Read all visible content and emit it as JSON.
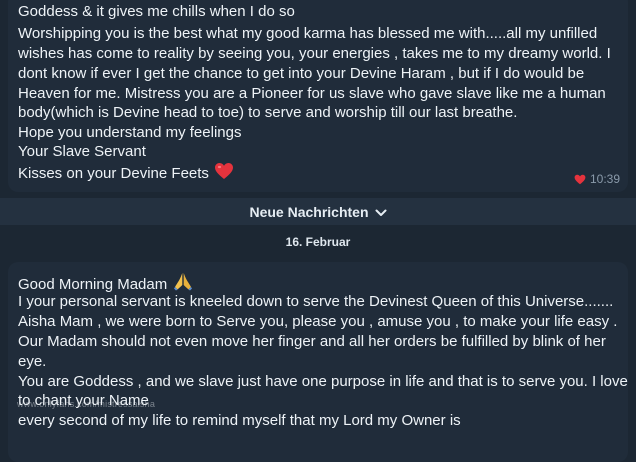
{
  "message_top": {
    "lines": [
      "Goddess & it gives me chills when I do so",
      "Worshipping you is the best what my good karma has blessed me with.....all my unfilled",
      "wishes has come to reality by seeing you,  your energies , takes me to my dreamy world. I",
      "dont know if ever I get the chance to get into your Devine Haram , but if I do would be",
      "Heaven for me. Mistress you are a Pioneer for us slave who gave slave like me a human",
      "body(which is Devine head to toe) to serve and worship till our last breathe.",
      "Hope you understand my feelings",
      "Your Slave Servant",
      "Kisses on your Devine Feets"
    ],
    "emoji": "❤️",
    "reaction_icon": "heart-icon",
    "time": "10:39"
  },
  "new_messages": {
    "label": "Neue Nachrichten",
    "icon": "chevron-down-icon"
  },
  "date_divider": "16. Februar",
  "message_bottom": {
    "lines": [
      "Good Morning Madam",
      "I your personal servant is kneeled down to serve the Devinest Queen of this Universe.......",
      "Aisha Mam , we were born to Serve you, please you , amuse you , to make your life easy .",
      "Our Madam should not even move her finger and all her orders be fulfilled by blink of her",
      "eye.",
      "You are Goddess , and we slave just have one purpose in life and that is to serve you. I love",
      "to chant your Name",
      "every second of my life to remind myself that my Lord my Owner is"
    ],
    "emoji": "🙏"
  },
  "watermark": "www.onlyfans.com/mistressaisha",
  "colors": {
    "background": "#1c2733",
    "bubble": "#202c3a",
    "heart": "#e5333d",
    "meta": "#8a9aaa"
  }
}
